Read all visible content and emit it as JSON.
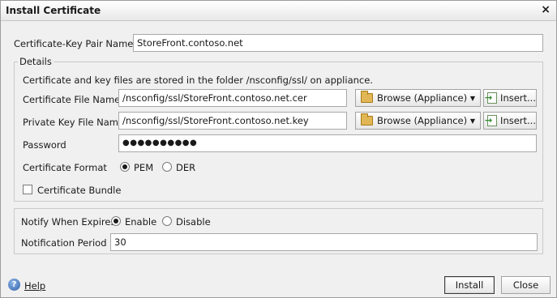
{
  "window": {
    "title": "Install Certificate",
    "close_glyph": "×"
  },
  "form": {
    "keypair_label": "Certificate-Key Pair Name*",
    "keypair_value": "StoreFront.contoso.net",
    "details": {
      "legend": "Details",
      "note": "Certificate and key files are stored in the folder /nsconfig/ssl/ on appliance.",
      "cert_file_label": "Certificate File Name*",
      "cert_file_value": "/nsconfig/ssl/StoreFront.contoso.net.cer",
      "key_file_label": "Private Key File Name",
      "key_file_value": "/nsconfig/ssl/StoreFront.contoso.net.key",
      "browse_label": "Browse (Appliance)",
      "insert_label": "Insert...",
      "password_label": "Password",
      "password_mask": "●●●●●●●●●●",
      "format_label": "Certificate Format",
      "format_options": [
        "PEM",
        "DER"
      ],
      "format_selected": "PEM",
      "bundle_label": "Certificate Bundle",
      "bundle_checked": false
    },
    "notify": {
      "label": "Notify When Expires",
      "options": [
        "Enable",
        "Disable"
      ],
      "selected": "Enable",
      "period_label": "Notification Period",
      "period_value": "30"
    }
  },
  "footer": {
    "help_label": "Help",
    "install_label": "Install",
    "close_label": "Close"
  },
  "icons": [
    "close-icon",
    "folder-icon",
    "dropdown-caret-icon",
    "insert-icon",
    "help-icon"
  ]
}
